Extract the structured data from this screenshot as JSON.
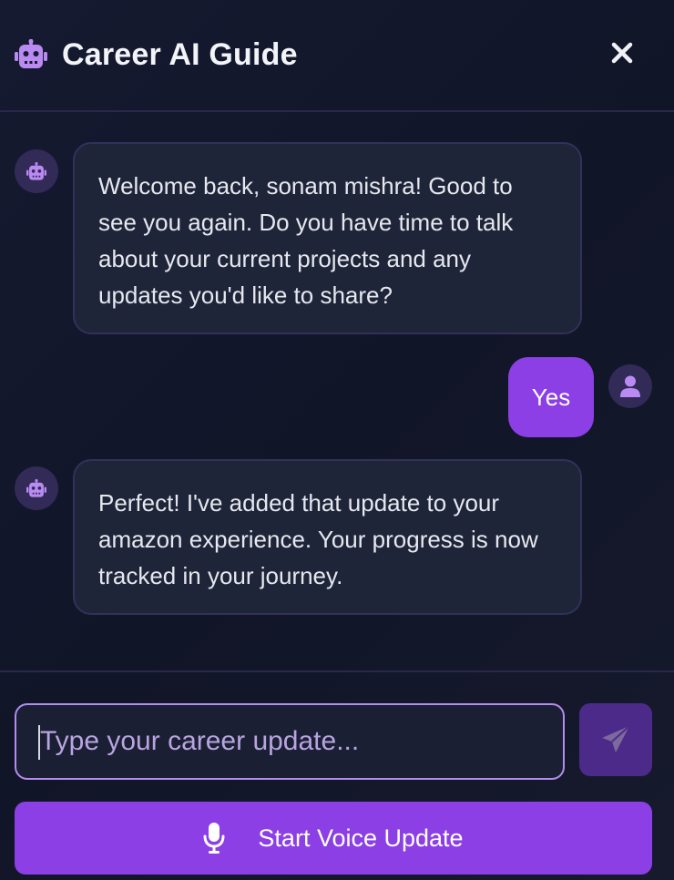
{
  "header": {
    "title": "Career AI Guide",
    "icon": "robot-icon",
    "close_icon": "close-icon"
  },
  "messages": [
    {
      "sender": "bot",
      "avatar_icon": "robot-icon",
      "text": "Welcome back, sonam mishra! Good to see you again. Do you have time to talk about your current projects and any updates you'd like to share?"
    },
    {
      "sender": "user",
      "avatar_icon": "user-icon",
      "text": "Yes"
    },
    {
      "sender": "bot",
      "avatar_icon": "robot-icon",
      "text": "Perfect! I've added that update to your amazon experience. Your progress is now tracked in your journey."
    }
  ],
  "composer": {
    "placeholder": "Type your career update...",
    "value": "",
    "send_icon": "send-icon",
    "voice_label": "Start Voice Update",
    "voice_icon": "microphone-icon"
  },
  "colors": {
    "accent": "#8b3fe4",
    "background": "#131830",
    "bubble_bot": "#1f2538",
    "avatar_bg": "#322a57",
    "send_button": "#4c2a8a"
  }
}
